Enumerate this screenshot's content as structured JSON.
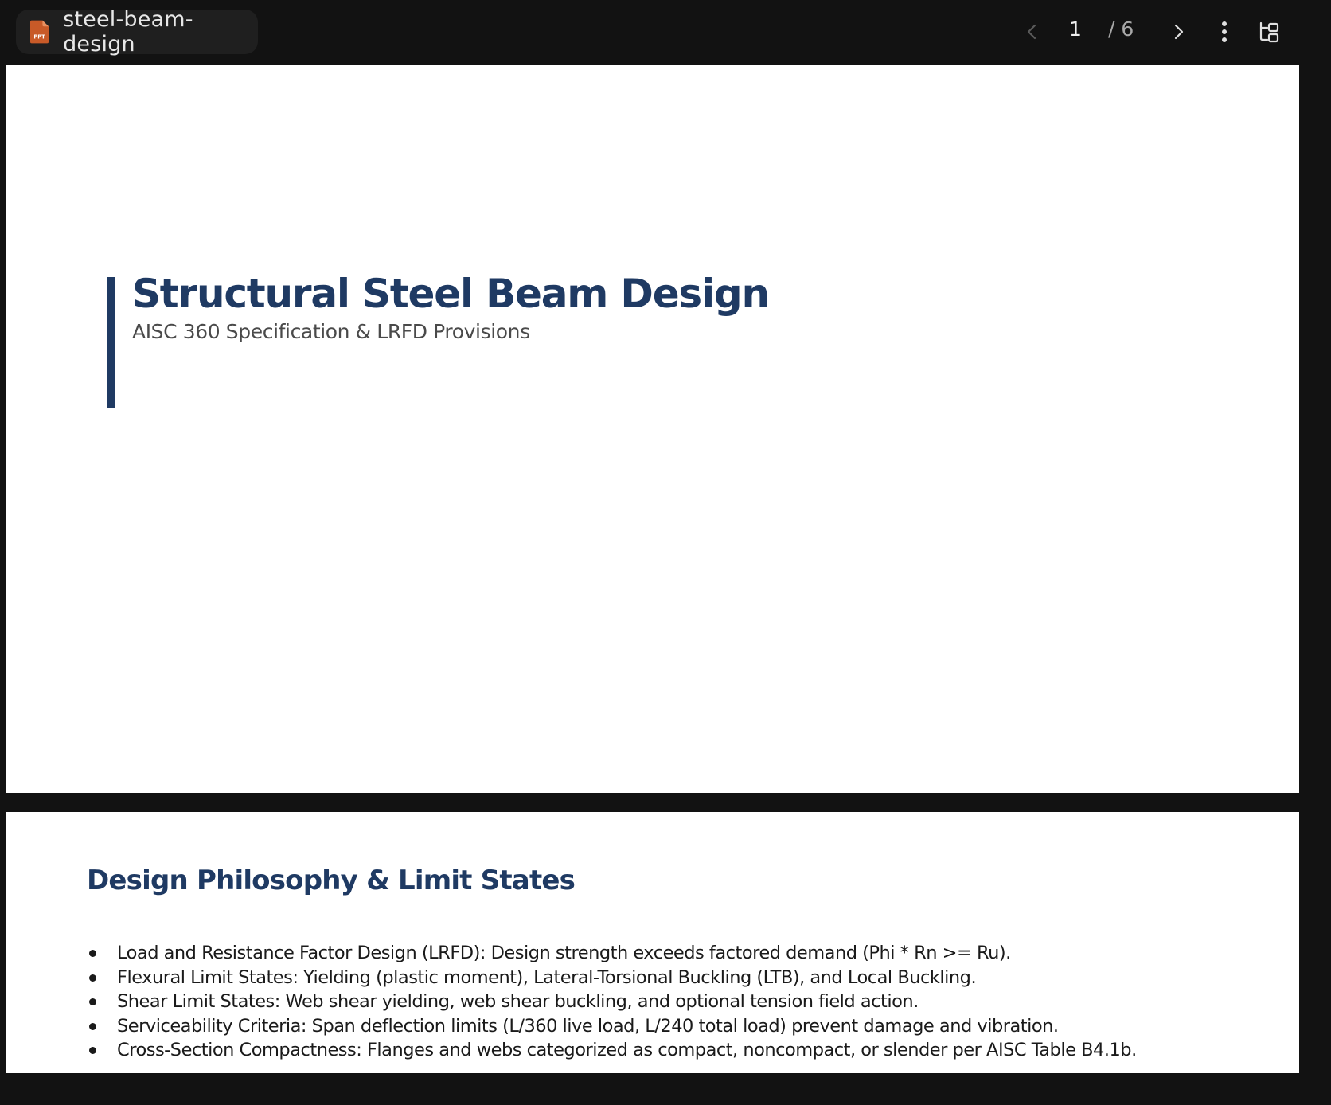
{
  "header": {
    "file_type_icon": "ppt-file-icon",
    "file_type_label": "PPT",
    "file_name": "steel-beam-design",
    "current_page": "1",
    "total_pages": "/ 6",
    "icons": [
      "chevron-left-icon",
      "chevron-right-icon",
      "more-vertical-icon",
      "outline-panel-icon"
    ]
  },
  "slides": {
    "slide1": {
      "title": "Structural Steel Beam Design",
      "subtitle": "AISC 360 Specification & LRFD Provisions"
    },
    "slide2": {
      "heading": "Design Philosophy & Limit States",
      "bullets": [
        "Load and Resistance Factor Design (LRFD): Design strength exceeds factored demand (Phi * Rn >= Ru).",
        "Flexural Limit States: Yielding (plastic moment), Lateral-Torsional Buckling (LTB), and Local Buckling.",
        "Shear Limit States: Web shear yielding, web shear buckling, and optional tension field action.",
        "Serviceability Criteria: Span deflection limits (L/360 live load, L/240 total load) prevent damage and vibration.",
        "Cross-Section Compactness: Flanges and webs categorized as compact, noncompact, or slender per AISC Table B4.1b."
      ]
    }
  },
  "colors": {
    "accent": "#1f3a63",
    "ppt_icon": "#c85a28",
    "background": "#121212",
    "chip": "#1f1f1f"
  }
}
